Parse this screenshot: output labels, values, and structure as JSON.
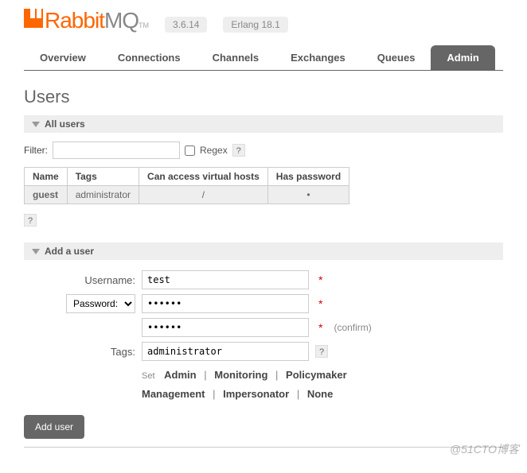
{
  "header": {
    "logo_text_rabbit": "Rabbit",
    "logo_text_mq": "MQ",
    "logo_tm": "TM",
    "version": "3.6.14",
    "erlang": "Erlang 18.1"
  },
  "nav": {
    "tabs": [
      {
        "label": "Overview"
      },
      {
        "label": "Connections"
      },
      {
        "label": "Channels"
      },
      {
        "label": "Exchanges"
      },
      {
        "label": "Queues"
      },
      {
        "label": "Admin"
      }
    ],
    "active": 5
  },
  "page_title": "Users",
  "all_users": {
    "header": "All users",
    "filter_label": "Filter:",
    "filter_value": "",
    "regex_label": "Regex",
    "help": "?",
    "columns": [
      "Name",
      "Tags",
      "Can access virtual hosts",
      "Has password"
    ],
    "rows": [
      {
        "name": "guest",
        "tags": "administrator",
        "vhosts": "/",
        "password": "•"
      }
    ]
  },
  "add_user": {
    "header": "Add a user",
    "username_label": "Username:",
    "username_value": "test",
    "password_select": "Password:",
    "password_value": "••••••",
    "password_confirm_value": "••••••",
    "confirm_label": "(confirm)",
    "tags_label": "Tags:",
    "tags_value": "administrator",
    "set_label": "Set",
    "tag_options": [
      "Admin",
      "Monitoring",
      "Policymaker",
      "Management",
      "Impersonator",
      "None"
    ],
    "button": "Add user",
    "required": "*",
    "help": "?"
  },
  "watermark": "@51CTO博客"
}
